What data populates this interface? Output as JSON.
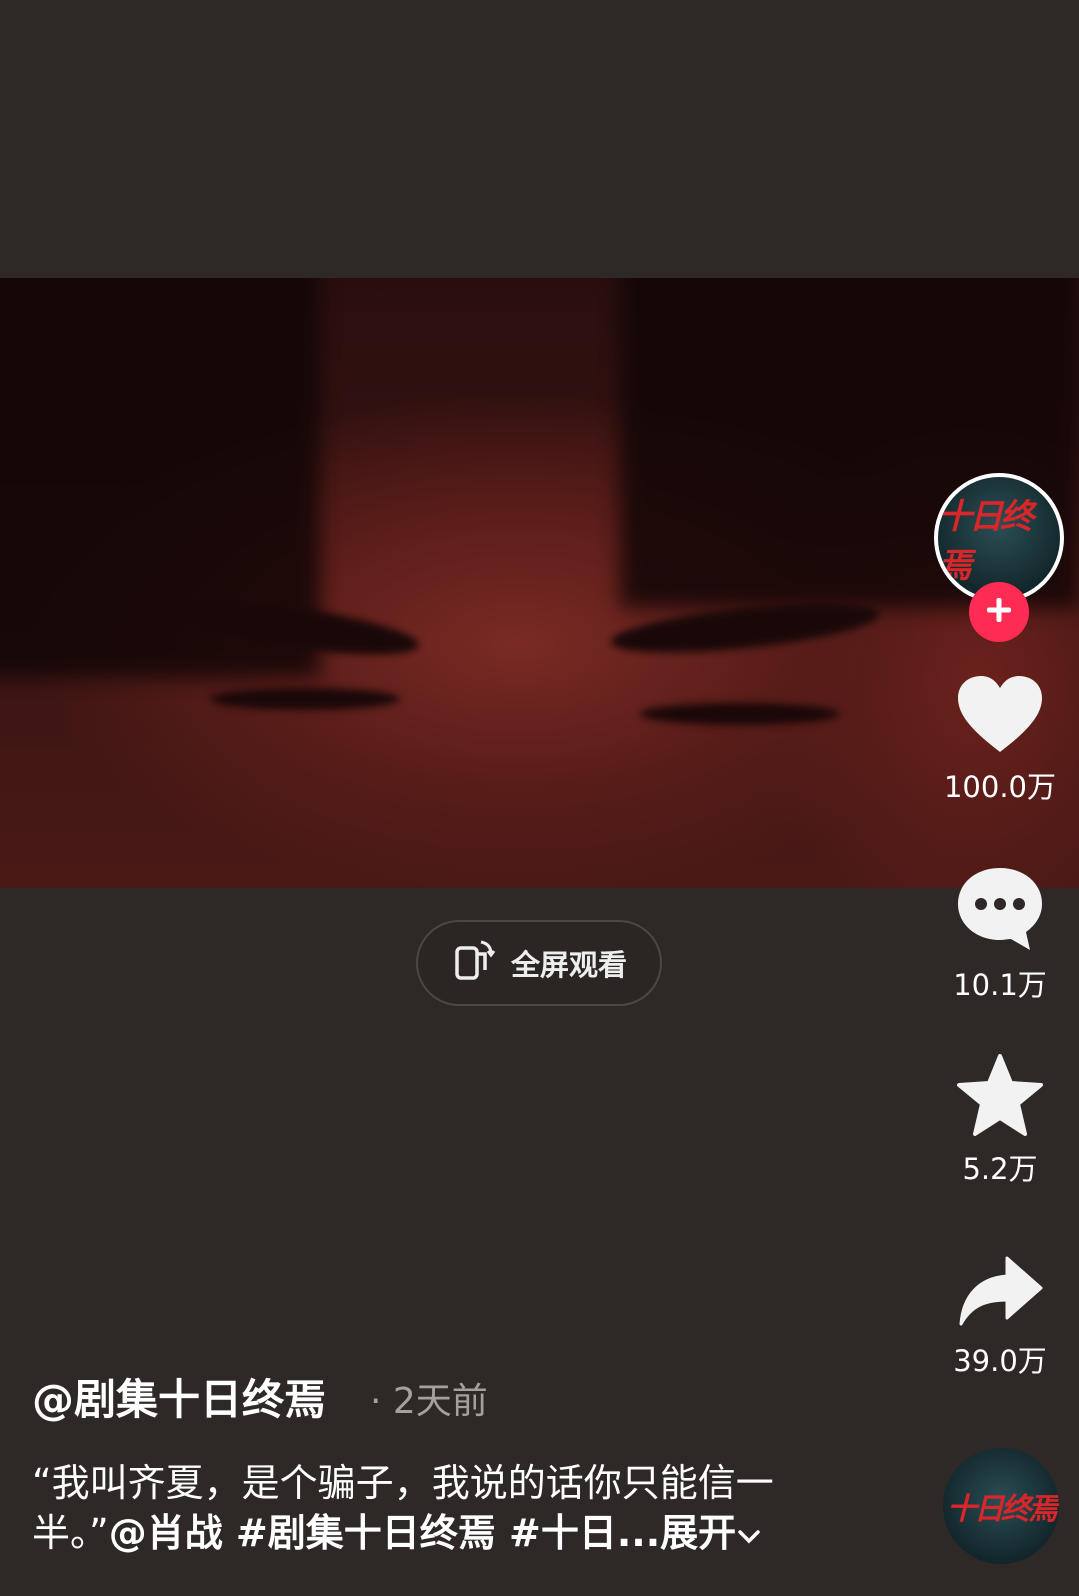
{
  "video": {
    "fullscreen_label": "全屏观看"
  },
  "creator": {
    "avatar_text": "十日终焉"
  },
  "actions": {
    "like_count": "100.0万",
    "comment_count": "10.1万",
    "favorite_count": "5.2万",
    "share_count": "39.0万"
  },
  "post": {
    "author": "@剧集十日终焉",
    "time": "· 2天前",
    "caption_line1": "“我叫齐夏，是个骗子，我说的话你只能信一",
    "caption_line2_a": "半。”",
    "caption_mention": "@肖战",
    "caption_tags": " #剧集十日终焉 #十日...",
    "expand_label": "展开"
  },
  "colors": {
    "accent": "#fe2c55",
    "background": "#2e2827",
    "logo_red": "#d9262a"
  },
  "icons": [
    "rotate-screen-icon",
    "plus-icon",
    "heart-icon",
    "comment-icon",
    "star-icon",
    "share-icon",
    "chevron-down-icon"
  ]
}
